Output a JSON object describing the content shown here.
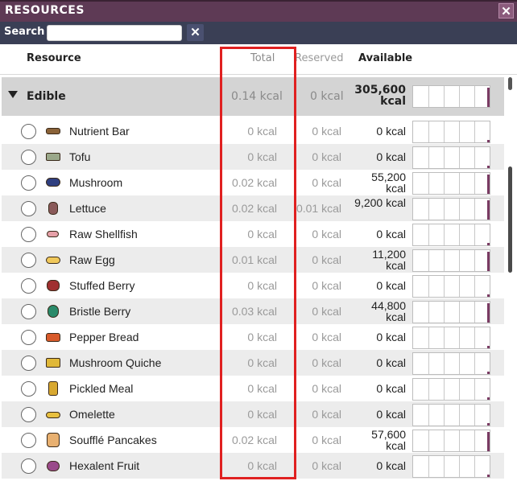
{
  "title": "RESOURCES",
  "search": {
    "label": "Search",
    "value": "",
    "clear_icon": "close-icon"
  },
  "columns": {
    "resource": "Resource",
    "total": "Total",
    "reserved": "Reserved",
    "available": "Available"
  },
  "group": {
    "name": "Edible",
    "total": "0.14 kcal",
    "reserved": "0 kcal",
    "available": "305,600 kcal"
  },
  "rows": [
    {
      "name": "Nutrient Bar",
      "total": "0 kcal",
      "reserved": "0 kcal",
      "available": "0 kcal",
      "icon": "nutrient-bar-icon"
    },
    {
      "name": "Tofu",
      "total": "0 kcal",
      "reserved": "0 kcal",
      "available": "0 kcal",
      "icon": "tofu-icon"
    },
    {
      "name": "Mushroom",
      "total": "0.02 kcal",
      "reserved": "0 kcal",
      "available": "55,200 kcal",
      "icon": "mushroom-icon"
    },
    {
      "name": "Lettuce",
      "total": "0.02 kcal",
      "reserved": "0.01 kcal",
      "available": "9,200 kcal",
      "icon": "lettuce-icon"
    },
    {
      "name": "Raw Shellfish",
      "total": "0 kcal",
      "reserved": "0 kcal",
      "available": "0 kcal",
      "icon": "raw-shellfish-icon"
    },
    {
      "name": "Raw Egg",
      "total": "0.01 kcal",
      "reserved": "0 kcal",
      "available": "11,200 kcal",
      "icon": "raw-egg-icon"
    },
    {
      "name": "Stuffed Berry",
      "total": "0 kcal",
      "reserved": "0 kcal",
      "available": "0 kcal",
      "icon": "stuffed-berry-icon"
    },
    {
      "name": "Bristle Berry",
      "total": "0.03 kcal",
      "reserved": "0 kcal",
      "available": "44,800 kcal",
      "icon": "bristle-berry-icon"
    },
    {
      "name": "Pepper Bread",
      "total": "0 kcal",
      "reserved": "0 kcal",
      "available": "0 kcal",
      "icon": "pepper-bread-icon"
    },
    {
      "name": "Mushroom Quiche",
      "total": "0 kcal",
      "reserved": "0 kcal",
      "available": "0 kcal",
      "icon": "mushroom-quiche-icon"
    },
    {
      "name": "Pickled Meal",
      "total": "0 kcal",
      "reserved": "0 kcal",
      "available": "0 kcal",
      "icon": "pickled-meal-icon"
    },
    {
      "name": "Omelette",
      "total": "0 kcal",
      "reserved": "0 kcal",
      "available": "0 kcal",
      "icon": "omelette-icon"
    },
    {
      "name": "Soufflé Pancakes",
      "total": "0.02 kcal",
      "reserved": "0 kcal",
      "available": "57,600 kcal",
      "icon": "souffle-pancakes-icon"
    },
    {
      "name": "Hexalent Fruit",
      "total": "0 kcal",
      "reserved": "0 kcal",
      "available": "0 kcal",
      "icon": "hexalent-fruit-icon"
    }
  ],
  "colors": {
    "titlebar": "#5e3a55",
    "searchbar": "#3a3f55",
    "highlight": "#e02020",
    "spark_bar": "#7a3b63"
  }
}
